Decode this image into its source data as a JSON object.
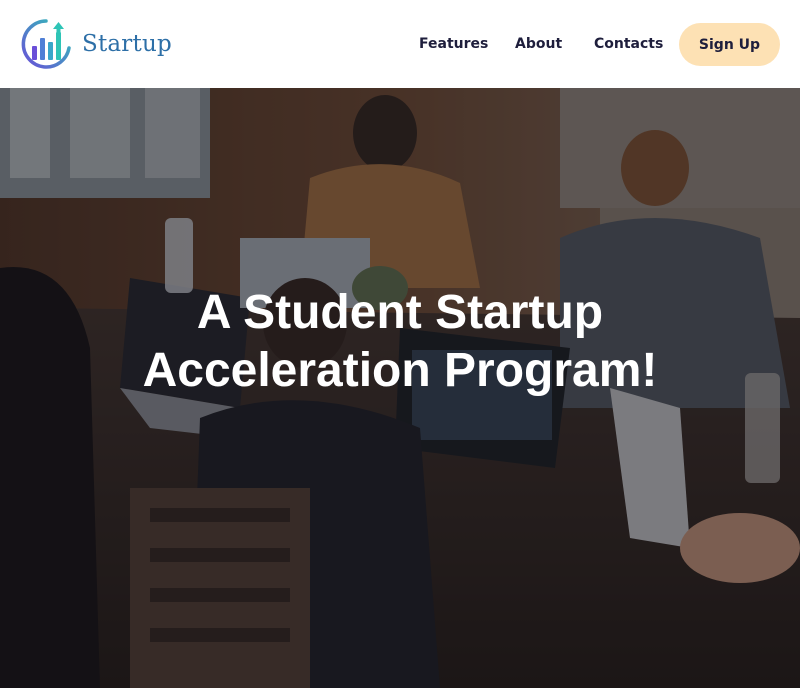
{
  "brand": {
    "name": "Startup",
    "logo_icon": "bar-chart-arrow-logo",
    "colors": {
      "primary": "#2d6fa7",
      "accent": "#2ec4b6",
      "purple": "#6a4fd8"
    }
  },
  "nav": {
    "items": [
      {
        "label": "Features"
      },
      {
        "label": "About"
      },
      {
        "label": "Contacts"
      }
    ],
    "cta": {
      "label": "Sign Up",
      "color": "#fde1b4"
    }
  },
  "hero": {
    "title_line1": "A Student Startup",
    "title_line2": "Acceleration Program!",
    "background": "team-working-on-laptops-photo"
  }
}
